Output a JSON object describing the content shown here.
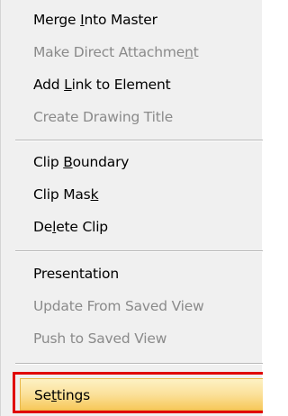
{
  "menu": {
    "items": [
      {
        "pre": "Merge ",
        "acc": "I",
        "post": "nto Master",
        "enabled": true
      },
      {
        "pre": "Make Direct Attachme",
        "acc": "n",
        "post": "t",
        "enabled": false
      },
      {
        "pre": "Add ",
        "acc": "L",
        "post": "ink to Element",
        "enabled": true
      },
      {
        "pre": "Create Drawing Title",
        "acc": "",
        "post": "",
        "enabled": false
      },
      {
        "pre": "Clip ",
        "acc": "B",
        "post": "oundary",
        "enabled": true
      },
      {
        "pre": "Clip Mas",
        "acc": "k",
        "post": "",
        "enabled": true
      },
      {
        "pre": "De",
        "acc": "l",
        "post": "ete Clip",
        "enabled": true
      },
      {
        "pre": "Presentation",
        "acc": "",
        "post": "",
        "enabled": true
      },
      {
        "pre": "Update From Saved View",
        "acc": "",
        "post": "",
        "enabled": false
      },
      {
        "pre": "Push to Saved View",
        "acc": "",
        "post": "",
        "enabled": false
      },
      {
        "pre": "Se",
        "acc": "t",
        "post": "tings",
        "enabled": true
      }
    ]
  },
  "colors": {
    "highlight_outline": "#e00000",
    "hover_fill": "#fbe19a",
    "disabled_text": "#8a8a8a"
  }
}
